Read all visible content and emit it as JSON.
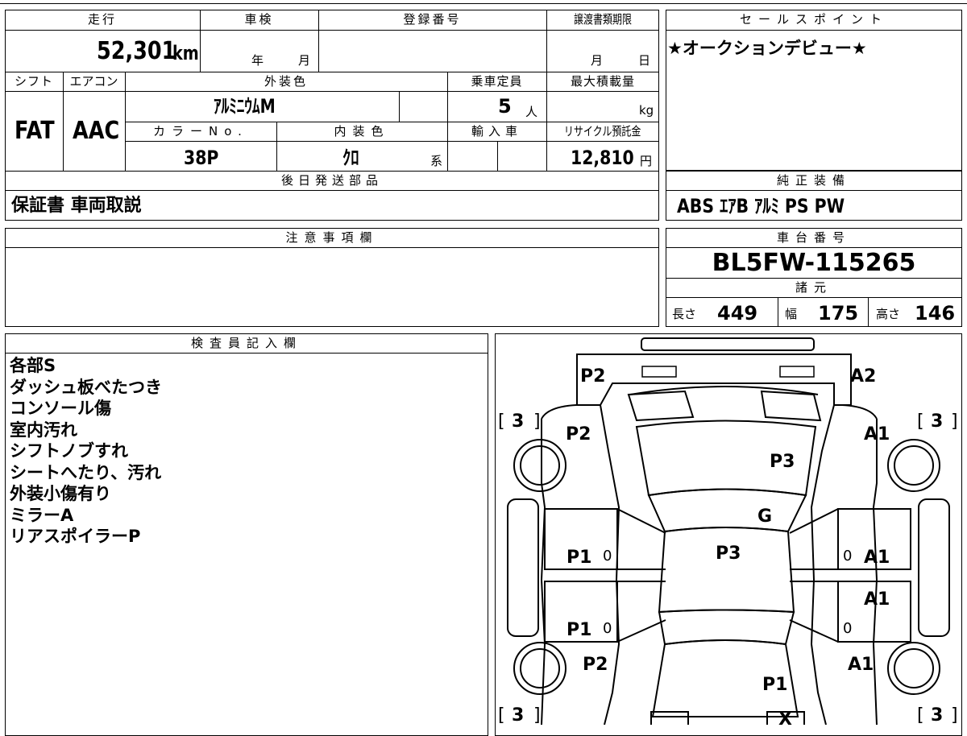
{
  "headers": {
    "mileage": "走行",
    "inspection": "車検",
    "registration_no": "登録番号",
    "transfer_deadline": "譲渡書類期限",
    "selling_point": "セールスポイント",
    "shift": "シフト",
    "aircon": "エアコン",
    "exterior_color": "外装色",
    "capacity": "乗車定員",
    "max_load": "最大積載量",
    "color_no": "カラーNo.",
    "interior_color": "内装色",
    "import_car": "輸入車",
    "recycle_fee": "リサイクル預託金",
    "later_parts": "後日発送部品",
    "genuine_equipment": "純正装備",
    "caution": "注意事項欄",
    "chassis_no": "車台番号",
    "specs": "諸元",
    "inspector": "検査員記入欄"
  },
  "values": {
    "mileage": "52,301",
    "mileage_unit": "km",
    "year_label": "年",
    "month_label": "月",
    "deadline_month": "月",
    "deadline_day": "日",
    "selling_point": "★オークションデビュー★",
    "shift": "FAT",
    "aircon": "AAC",
    "exterior_color": "ｱﾙﾐﾆｳﾑM",
    "capacity": "5",
    "capacity_unit": "人",
    "load_unit": "kg",
    "color_no": "38P",
    "interior_color": "ｸﾛ",
    "interior_suffix": "系",
    "recycle_fee": "12,810",
    "yen": "円",
    "later_parts": "保証書 車両取説",
    "equipment": "ABS ｴｱB ｱﾙﾐ PS PW",
    "chassis_no": "BL5FW-115265",
    "length_label": "長さ",
    "length": "449",
    "width_label": "幅",
    "width": "175",
    "height_label": "高さ",
    "height": "146"
  },
  "inspector_notes": [
    "各部S",
    "ダッシュ板べたつき",
    "コンソール傷",
    "室内汚れ",
    "シフトノブすれ",
    "シートへたり、汚れ",
    "外装小傷有り",
    "ミラーA",
    "リアスポイラーP"
  ],
  "diagram": {
    "front_left": "P2",
    "front_right": "A2",
    "front_fender_left": "P2",
    "front_fender_right": "A1",
    "hood": "P3",
    "windshield": "G",
    "roof": "P3",
    "front_door_left": "P1",
    "front_door_right": "A1",
    "rear_door_left": "P1",
    "rear_door_right": "A1",
    "rear_fender_left": "P2",
    "rear_fender_right": "A1",
    "trunk": "P1",
    "tire_fl": "3",
    "tire_fr": "3",
    "tire_rl": "3",
    "tire_rr": "3",
    "mirror_left_top": "0",
    "mirror_left_bottom": "0",
    "mirror_right_top": "0",
    "mirror_right_bottom": "0",
    "rear_mark": "X",
    "tire_bracket_open": "[",
    "tire_bracket_close": "]"
  }
}
